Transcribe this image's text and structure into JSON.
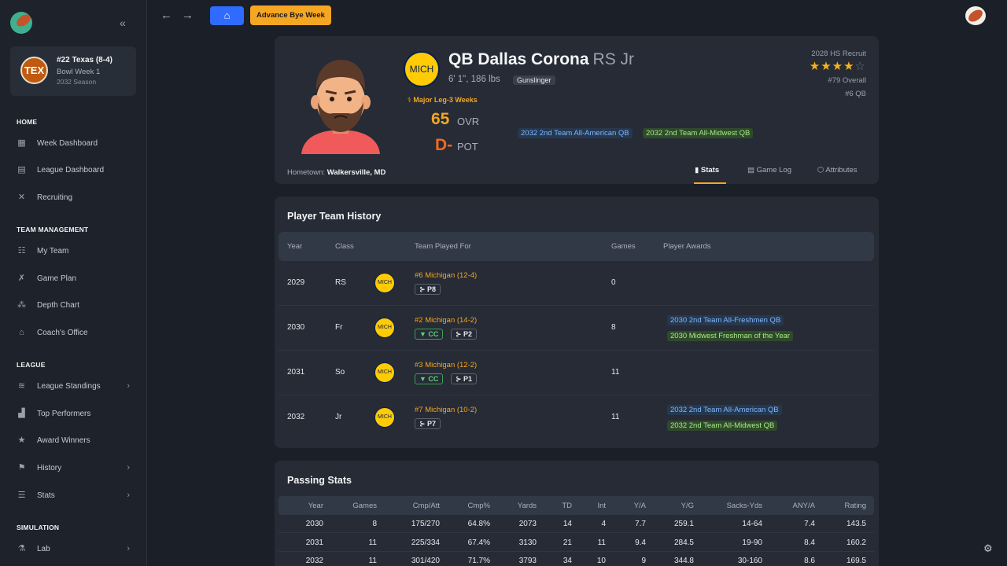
{
  "sidebar": {
    "team": {
      "badge": "TEX",
      "name": "#22 Texas (8-4)",
      "week": "Bowl Week 1",
      "season": "2032 Season"
    },
    "sections": [
      {
        "title": "HOME",
        "items": [
          {
            "label": "Week Dashboard",
            "icon": "grid-icon"
          },
          {
            "label": "League Dashboard",
            "icon": "table-icon"
          },
          {
            "label": "Recruiting",
            "icon": "whistle-icon"
          }
        ]
      },
      {
        "title": "TEAM MANAGEMENT",
        "items": [
          {
            "label": "My Team",
            "icon": "team-icon"
          },
          {
            "label": "Game Plan",
            "icon": "playbook-icon"
          },
          {
            "label": "Depth Chart",
            "icon": "depth-chart-icon"
          },
          {
            "label": "Coach's Office",
            "icon": "office-icon"
          }
        ]
      },
      {
        "title": "LEAGUE",
        "items": [
          {
            "label": "League Standings",
            "icon": "layers-icon"
          },
          {
            "label": "Top Performers",
            "icon": "podium-icon"
          },
          {
            "label": "Award Winners",
            "icon": "trophy-icon"
          },
          {
            "label": "History",
            "icon": "history-icon"
          },
          {
            "label": "Stats",
            "icon": "database-icon"
          }
        ]
      },
      {
        "title": "SIMULATION",
        "items": [
          {
            "label": "Lab",
            "icon": "flask-icon"
          }
        ]
      }
    ]
  },
  "topbar": {
    "advance_label": "Advance Bye Week"
  },
  "player": {
    "school": "MICH",
    "name": "QB Dallas Corona",
    "class": "RS Jr",
    "size": "6' 1\", 186 lbs",
    "archetype": "Gunslinger",
    "injury": "Major Leg-3 Weeks",
    "ovr": "65",
    "ovr_label": "OVR",
    "pot": "D-",
    "pot_label": "POT",
    "awards": [
      "2032 2nd Team All-American QB",
      "2032 2nd Team All-Midwest QB"
    ],
    "recruit": "2028 HS Recruit",
    "stars": 4,
    "overall_rank": "#79 Overall",
    "position_rank": "#6 QB",
    "hometown_label": "Hometown:",
    "hometown": "Walkersville, MD",
    "tabs": [
      "Stats",
      "Game Log",
      "Attributes"
    ]
  },
  "team_history": {
    "title": "Player Team History",
    "headers": [
      "Year",
      "Class",
      "Team Played For",
      "Games",
      "Player Awards"
    ],
    "rows": [
      {
        "year": "2029",
        "class": "RS",
        "logo": "MICH",
        "team": "#6 Michigan (12-4)",
        "cc": false,
        "playoff": "P8",
        "games": "0",
        "awards": []
      },
      {
        "year": "2030",
        "class": "Fr",
        "logo": "MICH",
        "team": "#2 Michigan (14-2)",
        "cc": true,
        "playoff": "P2",
        "games": "8",
        "awards": [
          {
            "text": "2030 2nd Team All-Freshmen QB",
            "color": "blue"
          },
          {
            "text": "2030 Midwest Freshman of the Year",
            "color": "green"
          }
        ]
      },
      {
        "year": "2031",
        "class": "So",
        "logo": "MICH",
        "team": "#3 Michigan (12-2)",
        "cc": true,
        "playoff": "P1",
        "games": "11",
        "awards": []
      },
      {
        "year": "2032",
        "class": "Jr",
        "logo": "MICH",
        "team": "#7 Michigan (10-2)",
        "cc": false,
        "playoff": "P7",
        "games": "11",
        "awards": [
          {
            "text": "2032 2nd Team All-American QB",
            "color": "blue"
          },
          {
            "text": "2032 2nd Team All-Midwest QB",
            "color": "green"
          }
        ]
      }
    ],
    "cc_label": "CC"
  },
  "passing": {
    "title": "Passing Stats",
    "headers": [
      "Year",
      "Games",
      "Cmp/Att",
      "Cmp%",
      "Yards",
      "TD",
      "Int",
      "Y/A",
      "Y/G",
      "Sacks-Yds",
      "ANY/A",
      "Rating"
    ],
    "rows": [
      [
        "2030",
        "8",
        "175/270",
        "64.8%",
        "2073",
        "14",
        "4",
        "7.7",
        "259.1",
        "14-64",
        "7.4",
        "143.5"
      ],
      [
        "2031",
        "11",
        "225/334",
        "67.4%",
        "3130",
        "21",
        "11",
        "9.4",
        "284.5",
        "19-90",
        "8.4",
        "160.2"
      ],
      [
        "2032",
        "11",
        "301/420",
        "71.7%",
        "3793",
        "34",
        "10",
        "9",
        "344.8",
        "30-160",
        "8.6",
        "169.5"
      ]
    ]
  }
}
